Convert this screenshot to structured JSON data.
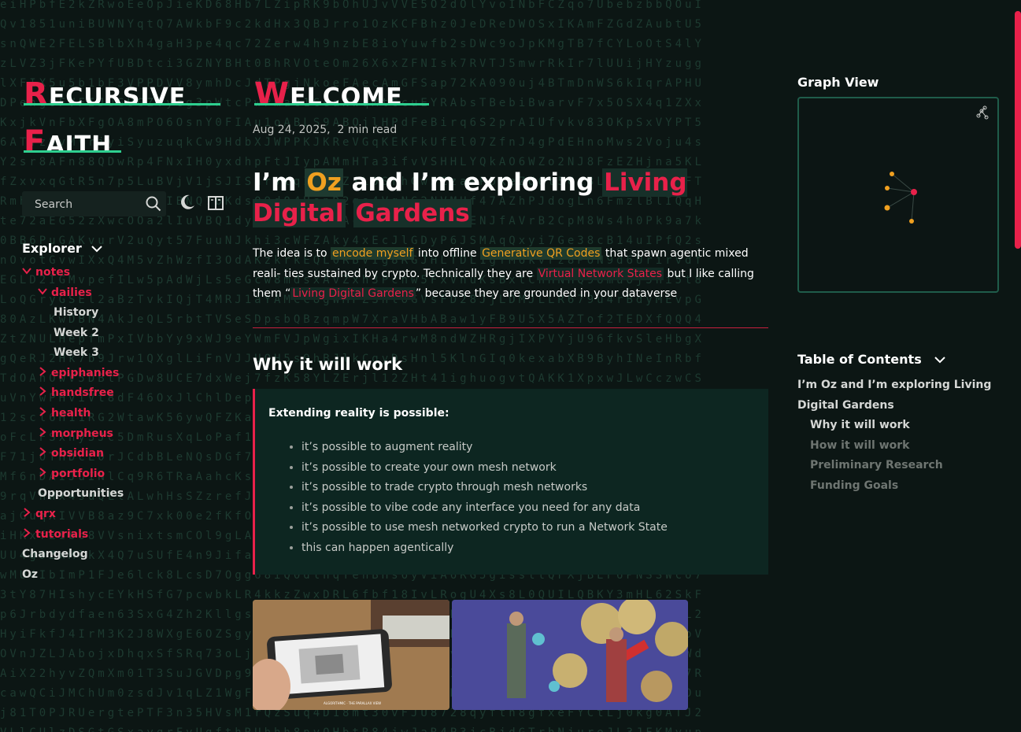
{
  "site": {
    "logo_line1_first": "R",
    "logo_line1_rest": "ECURSIVE",
    "logo_line2_first": "F",
    "logo_line2_rest": "AITH"
  },
  "search": {
    "placeholder": "Search"
  },
  "explorer": {
    "title": "Explorer",
    "items": [
      {
        "label": "notes",
        "type": "folder",
        "open": true
      },
      {
        "label": "dailies",
        "type": "folder",
        "open": true
      },
      {
        "label": "History",
        "type": "file"
      },
      {
        "label": "Week 2",
        "type": "file"
      },
      {
        "label": "Week 3",
        "type": "file"
      },
      {
        "label": "epiphanies",
        "type": "folder"
      },
      {
        "label": "handsfree",
        "type": "folder"
      },
      {
        "label": "health",
        "type": "folder"
      },
      {
        "label": "morpheus",
        "type": "folder"
      },
      {
        "label": "obsidian",
        "type": "folder"
      },
      {
        "label": "portfolio",
        "type": "folder"
      },
      {
        "label": "Opportunities",
        "type": "file"
      },
      {
        "label": "qrx",
        "type": "folder"
      },
      {
        "label": "tutorials",
        "type": "folder"
      },
      {
        "label": "Changelog",
        "type": "file"
      },
      {
        "label": "Oz",
        "type": "file"
      }
    ]
  },
  "article": {
    "title_first": "W",
    "title_rest": "ELCOME",
    "date": "Aug 24, 2025,",
    "read_time": "2 min read",
    "h1_part1": "I’m ",
    "h1_oz": "Oz",
    "h1_part2": " and I’m exploring ",
    "h1_highlight1": "Living Digital",
    "h1_highlight2": "Gardens",
    "para_1": "The idea is to ",
    "link_encode": "encode myself",
    "para_2": " into offline ",
    "link_qr": "Generative QR Codes",
    "para_3": " that spawn agentic mixed reali- ties sustained by crypto. Technically they are ",
    "link_vns": "Virtual Network States",
    "para_4": " but I like calling them “",
    "link_ldg": "Living Digital Gardens",
    "para_5": "” because they are grounded in your dataverse",
    "h2": "Why it will work",
    "callout_title": "Extending reality is possible:",
    "callout_items": [
      "it’s possible to augment reality",
      "it’s possible to create your own mesh network",
      "it’s possible to trade crypto through mesh networks",
      "it’s possible to vibe code any interface you need for any data",
      "it’s possible to use mesh networked crypto to run a Network State",
      "this can happen agentically"
    ],
    "image1_caption": "ALGORITHMIC · THE PARALLAX VIEW"
  },
  "graph": {
    "title": "Graph View"
  },
  "toc": {
    "title": "Table of Contents",
    "items": [
      {
        "line1": "I’m Oz and I’m exploring Living",
        "line2": "Digital Gardens"
      },
      {
        "label": "Why it will work"
      },
      {
        "label": "How it will work"
      },
      {
        "label": "Preliminary Research"
      },
      {
        "label": "Funding Goals"
      }
    ]
  },
  "colors": {
    "accent": "#e8214a",
    "highlight": "#f0a020",
    "green": "#2ecf8f",
    "background": "#0c1614"
  }
}
